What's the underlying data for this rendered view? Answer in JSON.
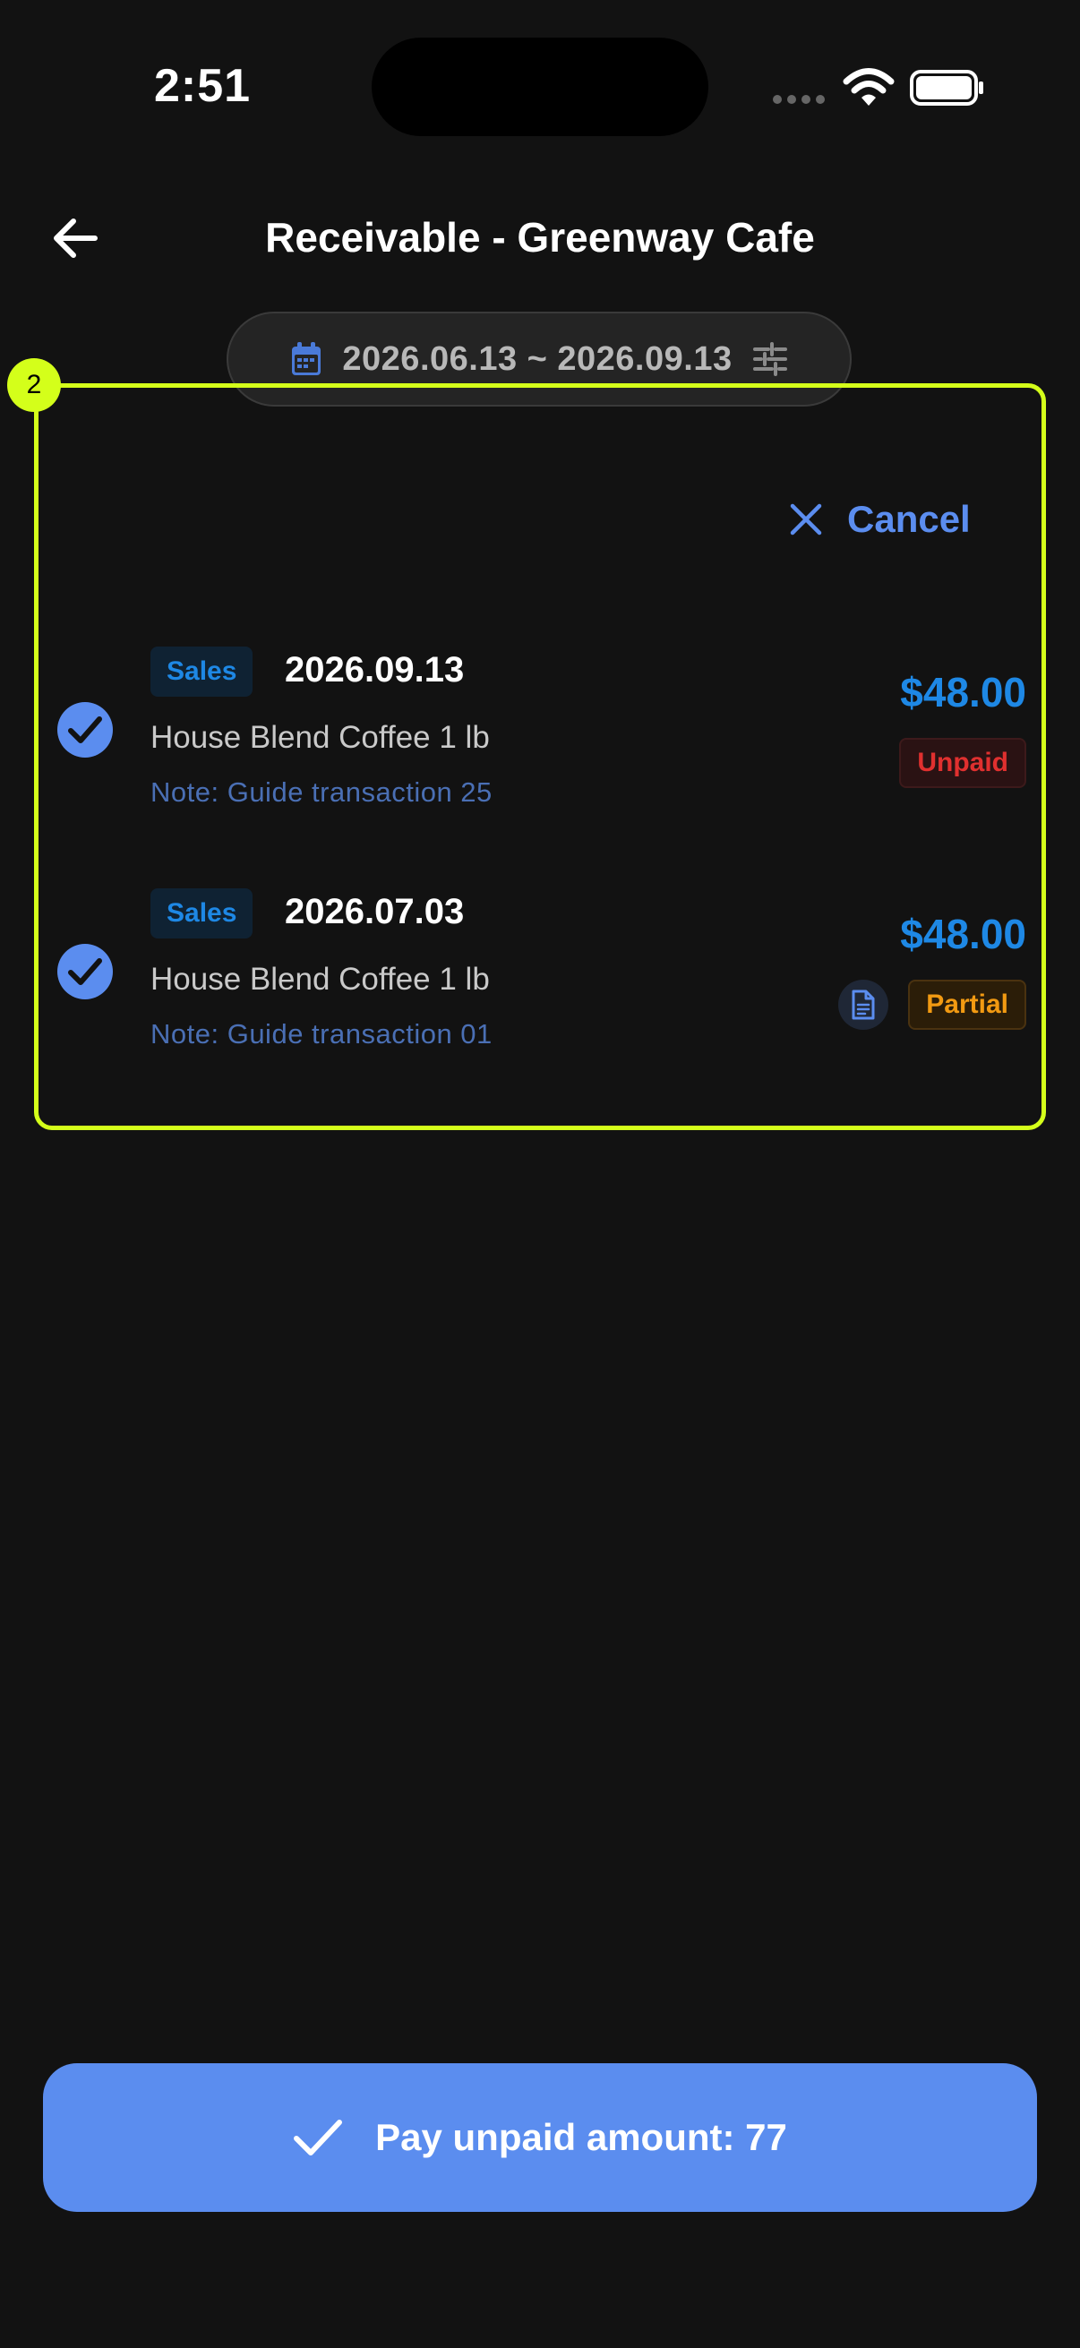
{
  "status_bar": {
    "time": "2:51"
  },
  "header": {
    "title": "Receivable - Greenway Cafe"
  },
  "filter": {
    "date_range": "2026.06.13 ~ 2026.09.13"
  },
  "selection": {
    "badge": "2",
    "cancel_label": "Cancel"
  },
  "transactions": [
    {
      "type": "Sales",
      "date": "2026.09.13",
      "item": "House Blend Coffee 1 lb",
      "note": "Note: Guide transaction 25",
      "amount": "$48.00",
      "status": "Unpaid"
    },
    {
      "type": "Sales",
      "date": "2026.07.03",
      "item": "House Blend Coffee 1 lb",
      "note": "Note: Guide transaction 01",
      "amount": "$48.00",
      "status": "Partial"
    }
  ],
  "footer": {
    "pay_label": "Pay unpaid amount: 77"
  },
  "colors": {
    "background": "#121212",
    "accent": "#5b8def",
    "amount_blue": "#1e88e5",
    "unpaid_red": "#e0302f",
    "partial_orange": "#f29a12",
    "highlight": "#d4ff1a"
  },
  "icons": {
    "back": "arrow-left-icon",
    "calendar": "calendar-icon",
    "filter": "sliders-icon",
    "cancel": "close-icon",
    "check": "check-circle-icon",
    "document": "document-icon",
    "pay": "checkmark-icon"
  }
}
